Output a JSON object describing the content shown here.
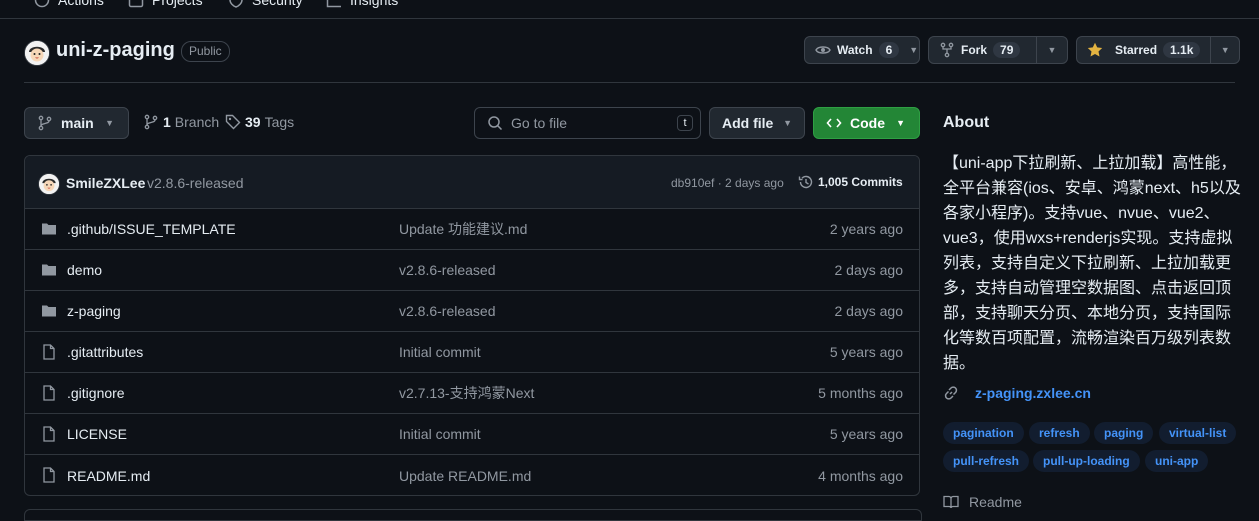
{
  "topnav": {
    "items": [
      "Actions",
      "Projects",
      "Security",
      "Insights"
    ]
  },
  "repo": {
    "name": "uni-z-paging",
    "visibility": "Public",
    "watch": {
      "label": "Watch",
      "count": "6"
    },
    "fork": {
      "label": "Fork",
      "count": "79"
    },
    "star": {
      "label": "Starred",
      "count": "1.1k"
    }
  },
  "controls": {
    "branch": "main",
    "branches_count": "1",
    "branches_label": "Branch",
    "tags_count": "39",
    "tags_label": "Tags",
    "search_placeholder": "Go to file",
    "search_shortcut": "t",
    "add_file": "Add file",
    "code": "Code"
  },
  "latest_commit": {
    "author": "SmileZXLee",
    "message": "v2.8.6-released",
    "hash_time": "db910ef · 2 days ago",
    "commits": "1,005 Commits"
  },
  "files": [
    {
      "type": "folder",
      "name": ".github/ISSUE_TEMPLATE",
      "message": "Update 功能建议.md",
      "age": "2 years ago"
    },
    {
      "type": "folder",
      "name": "demo",
      "message": "v2.8.6-released",
      "age": "2 days ago"
    },
    {
      "type": "folder",
      "name": "z-paging",
      "message": "v2.8.6-released",
      "age": "2 days ago"
    },
    {
      "type": "file",
      "name": ".gitattributes",
      "message": "Initial commit",
      "age": "5 years ago"
    },
    {
      "type": "file",
      "name": ".gitignore",
      "message": "v2.7.13-支持鸿蒙Next",
      "age": "5 months ago"
    },
    {
      "type": "file",
      "name": "LICENSE",
      "message": "Initial commit",
      "age": "5 years ago"
    },
    {
      "type": "file",
      "name": "README.md",
      "message": "Update README.md",
      "age": "4 months ago"
    }
  ],
  "about": {
    "title": "About",
    "description": "【uni-app下拉刷新、上拉加载】高性能，全平台兼容(ios、安卓、鸿蒙next、h5以及各家小程序)。支持vue、nvue、vue2、vue3，使用wxs+renderjs实现。支持虚拟列表，支持自定义下拉刷新、上拉加载更多，支持自动管理空数据图、点击返回顶部，支持聊天分页、本地分页，支持国际化等数百项配置，流畅渲染百万级列表数据。",
    "homepage": "z-paging.zxlee.cn",
    "topics": [
      "pagination",
      "refresh",
      "paging",
      "virtual-list",
      "pull-refresh",
      "pull-up-loading",
      "uni-app"
    ],
    "readme": "Readme"
  },
  "colors": {
    "background": "#0d1117",
    "accent_link": "#4493f8",
    "code_button": "#238636",
    "star": "#e3b341"
  }
}
